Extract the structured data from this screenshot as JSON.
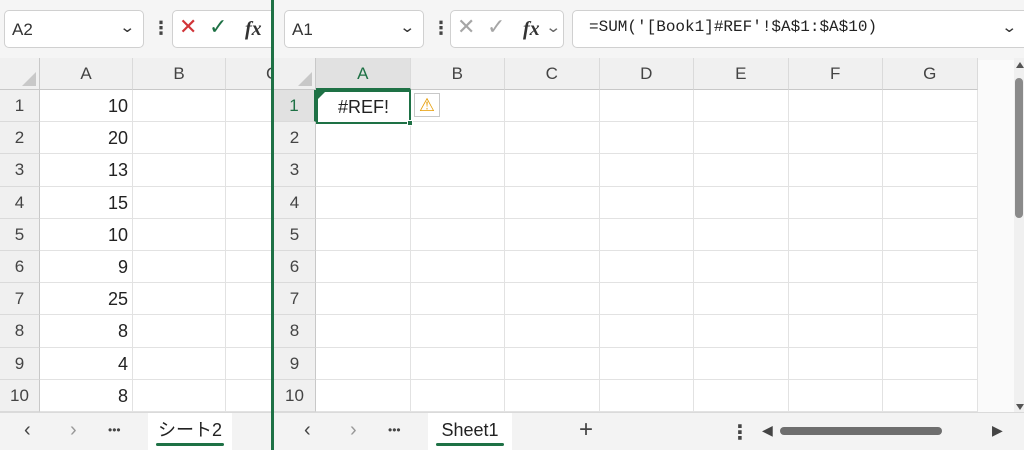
{
  "left_window": {
    "name_box": "A2",
    "cancel_icon": "✕",
    "enter_icon": "✓",
    "fx_label": "fx",
    "columns": [
      "A",
      "B",
      "C"
    ],
    "rows": [
      {
        "num": "1",
        "a": "10"
      },
      {
        "num": "2",
        "a": "20"
      },
      {
        "num": "3",
        "a": "13"
      },
      {
        "num": "4",
        "a": "15"
      },
      {
        "num": "5",
        "a": "10"
      },
      {
        "num": "6",
        "a": "9"
      },
      {
        "num": "7",
        "a": "25"
      },
      {
        "num": "8",
        "a": "8"
      },
      {
        "num": "9",
        "a": "4"
      },
      {
        "num": "10",
        "a": "8"
      }
    ],
    "sheet_tab": "シート2",
    "nav": {
      "prev": "‹",
      "next": "›",
      "more": "•••"
    }
  },
  "right_window": {
    "name_box": "A1",
    "cancel_icon": "✕",
    "enter_icon": "✓",
    "fx_label": "fx",
    "formula": "=SUM('[Book1]#REF'!$A$1:$A$10)",
    "columns": [
      "A",
      "B",
      "C",
      "D",
      "E",
      "F",
      "G"
    ],
    "row_numbers": [
      "1",
      "2",
      "3",
      "4",
      "5",
      "6",
      "7",
      "8",
      "9",
      "10"
    ],
    "cell_a1": "#REF!",
    "warning_icon": "⚠",
    "sheet_tab": "Sheet1",
    "add_sheet": "+",
    "nav": {
      "prev": "‹",
      "next": "›",
      "more": "•••",
      "options": "⋮"
    },
    "scroll": {
      "left": "◀",
      "right": "▶"
    }
  },
  "colors": {
    "accent": "#1e7145",
    "error_red": "#d13438",
    "warn_orange": "#f4b400"
  }
}
